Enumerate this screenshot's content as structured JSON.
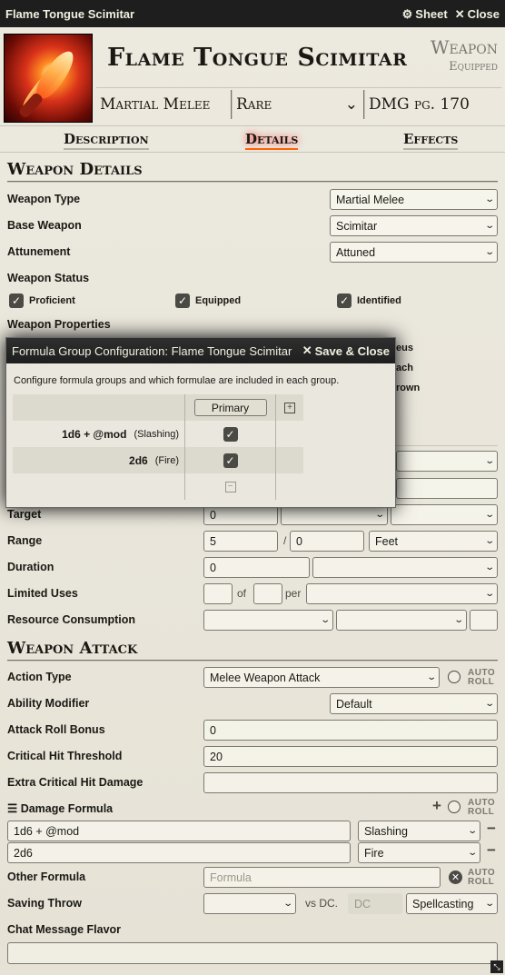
{
  "window": {
    "title": "Flame Tongue Scimitar",
    "sheet_label": "Sheet",
    "close_label": "Close"
  },
  "header": {
    "name": "Flame Tongue Scimitar",
    "type": "Weapon",
    "status": "Equipped",
    "weapon_category": "Martial Melee",
    "rarity": "Rare",
    "source": "DMG pg. 170"
  },
  "tabs": [
    {
      "label": "Description"
    },
    {
      "label": "Details",
      "active": true
    },
    {
      "label": "Effects"
    }
  ],
  "weapon_details": {
    "heading": "Weapon Details",
    "weapon_type": {
      "label": "Weapon Type",
      "value": "Martial Melee"
    },
    "base_weapon": {
      "label": "Base Weapon",
      "value": "Scimitar"
    },
    "attunement": {
      "label": "Attunement",
      "value": "Attuned"
    },
    "weapon_status": {
      "label": "Weapon Status",
      "proficient": "Proficient",
      "equipped": "Equipped",
      "identified": "Identified"
    },
    "weapon_properties": {
      "label": "Weapon Properties",
      "partial": [
        "eus",
        "ach",
        "rown"
      ]
    }
  },
  "usage": {
    "target": {
      "label": "Target",
      "value": "0"
    },
    "range": {
      "label": "Range",
      "value": "5",
      "long": "0",
      "units": "Feet"
    },
    "duration": {
      "label": "Duration",
      "value": "0"
    },
    "limited_uses": {
      "label": "Limited Uses",
      "of": "of",
      "per": "per"
    },
    "resource": {
      "label": "Resource Consumption"
    }
  },
  "weapon_attack": {
    "heading": "Weapon Attack",
    "action_type": {
      "label": "Action Type",
      "value": "Melee Weapon Attack"
    },
    "auto_roll": "AUTO ROLL",
    "ability_modifier": {
      "label": "Ability Modifier",
      "value": "Default"
    },
    "attack_roll_bonus": {
      "label": "Attack Roll Bonus",
      "value": "0"
    },
    "critical_threshold": {
      "label": "Critical Hit Threshold",
      "value": "20"
    },
    "extra_crit_damage": {
      "label": "Extra Critical Hit Damage",
      "value": ""
    },
    "damage_formula": {
      "label": "Damage Formula",
      "parts": [
        {
          "formula": "1d6 + @mod",
          "type": "Slashing"
        },
        {
          "formula": "2d6",
          "type": "Fire"
        }
      ]
    },
    "other_formula": {
      "label": "Other Formula",
      "placeholder": "Formula"
    },
    "saving_throw": {
      "label": "Saving Throw",
      "vs_dc": "vs DC.",
      "dc_placeholder": "DC",
      "scaling": "Spellcasting"
    },
    "chat_flavor": {
      "label": "Chat Message Flavor"
    }
  },
  "dialog": {
    "title": "Formula Group Configuration: Flame Tongue Scimitar",
    "save_close": "Save & Close",
    "instructions": "Configure formula groups and which formulae are included in each group.",
    "group_name": "Primary",
    "rows": [
      {
        "formula": "1d6 + @mod",
        "label": "(Slashing)",
        "checked": true
      },
      {
        "formula": "2d6",
        "label": "(Fire)",
        "checked": true
      }
    ]
  }
}
